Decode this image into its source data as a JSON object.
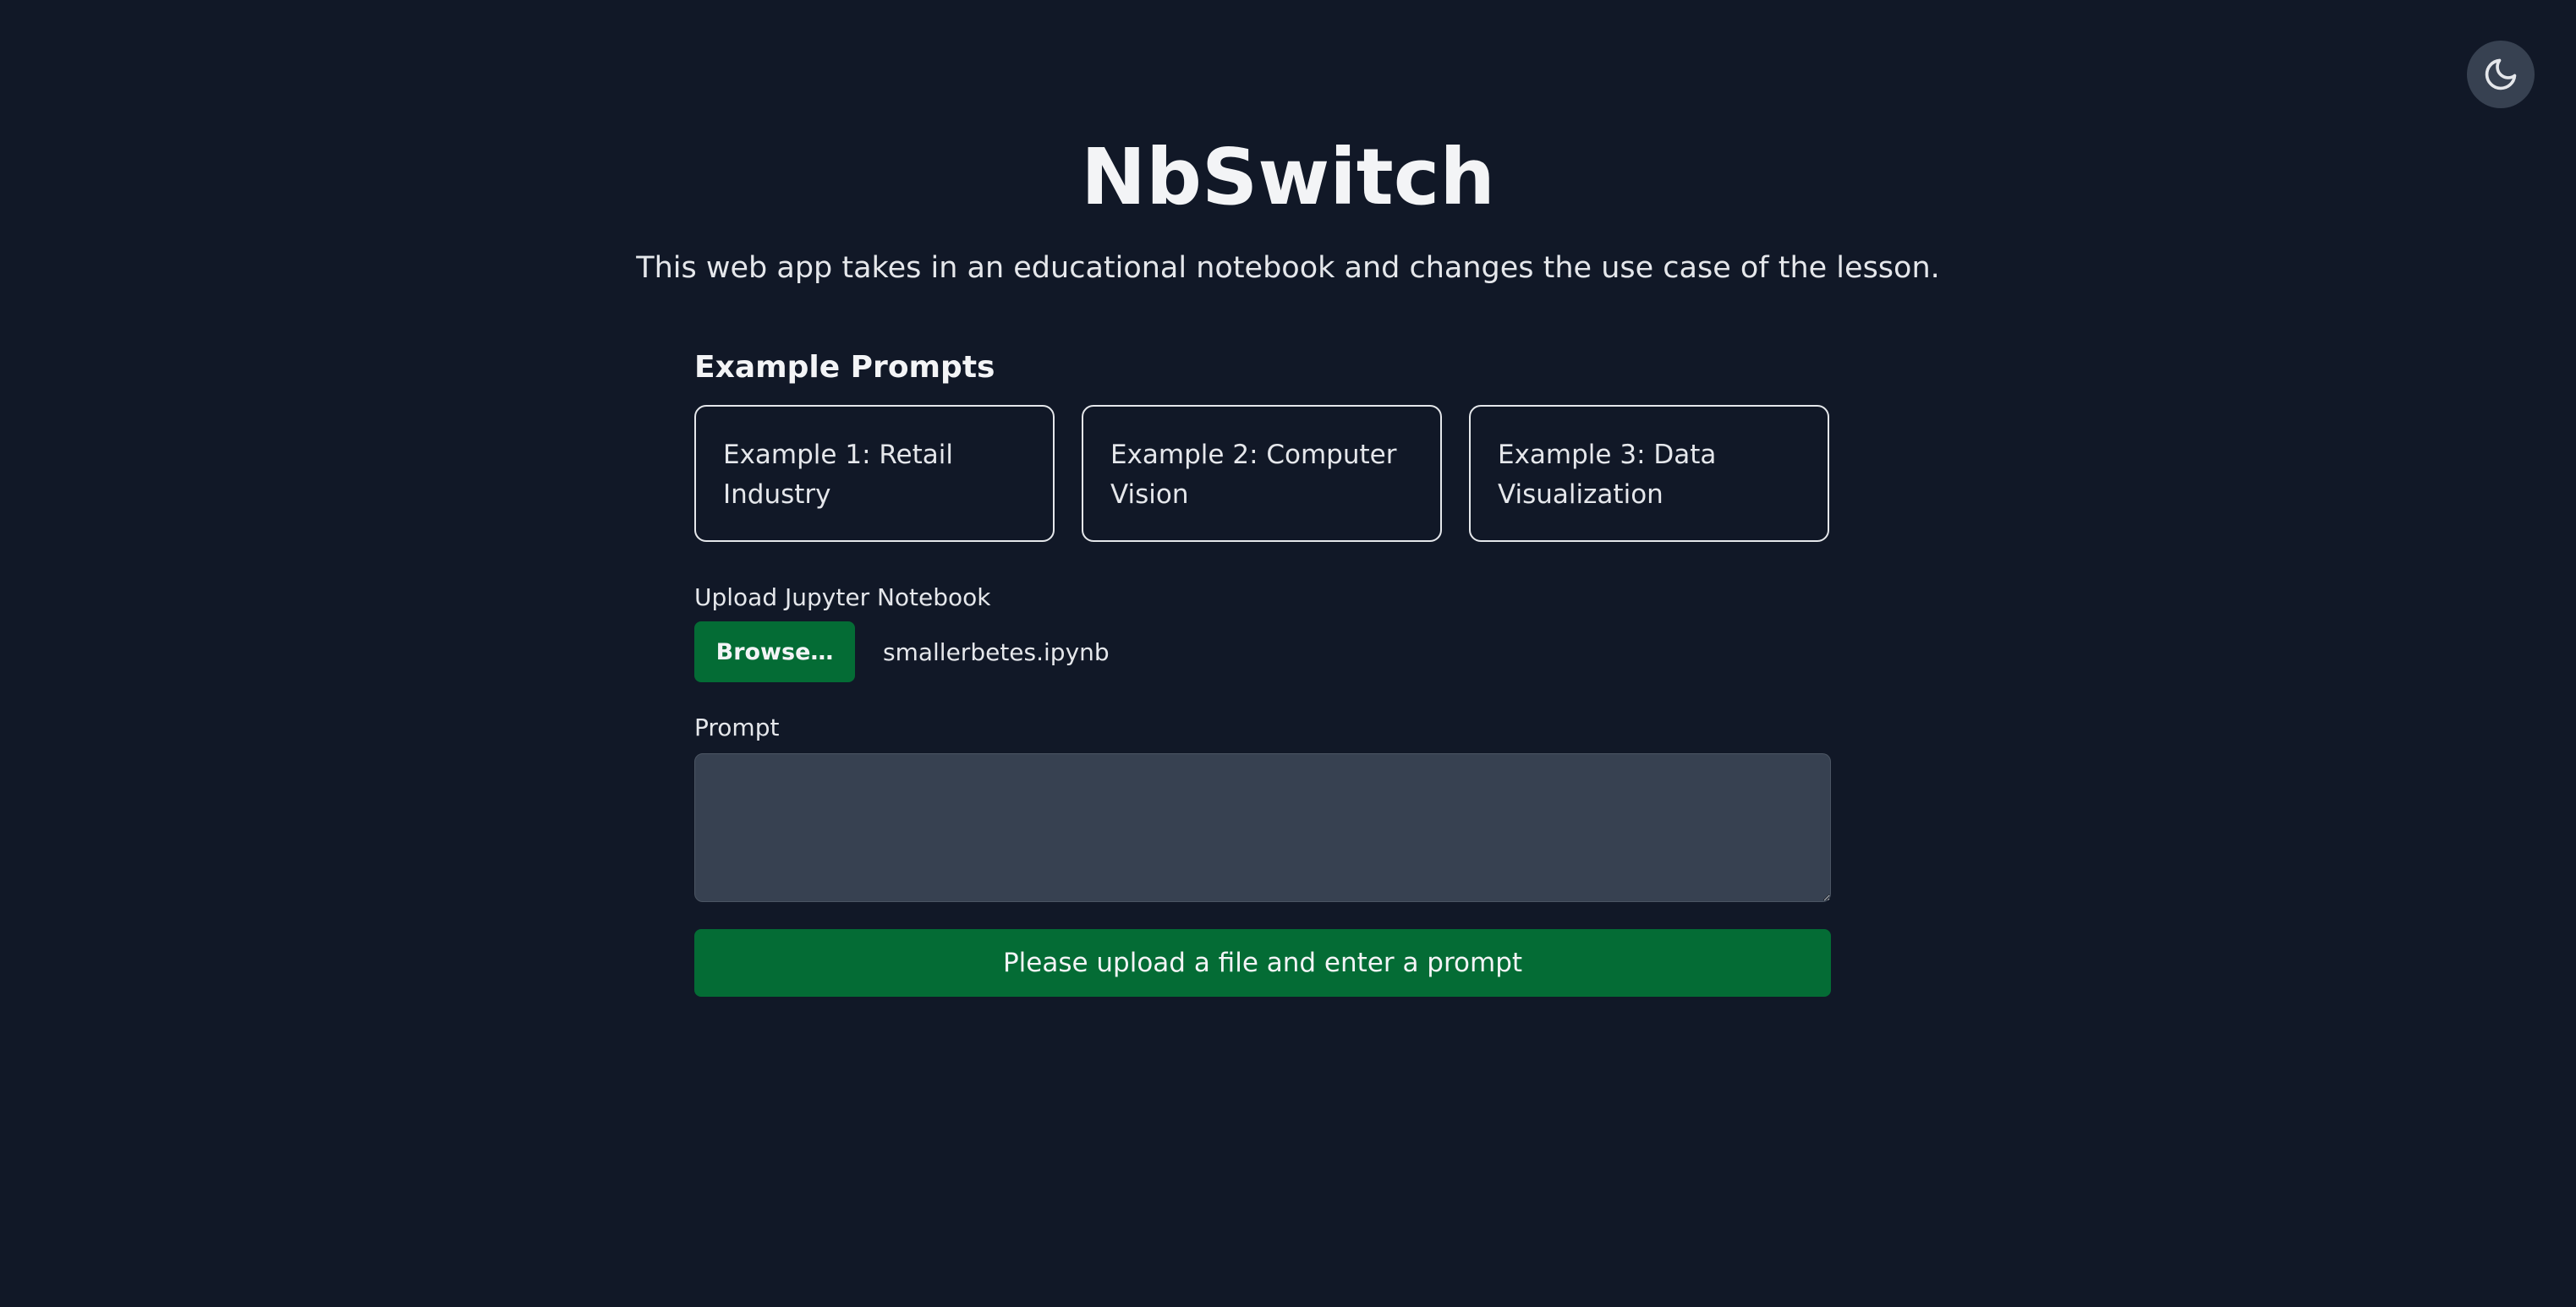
{
  "theme_toggle": {
    "icon": "moon-icon"
  },
  "header": {
    "title": "NbSwitch",
    "subtitle": "This web app takes in an educational notebook and changes the use case of the lesson."
  },
  "examples": {
    "title": "Example Prompts",
    "items": [
      {
        "label": "Example 1: Retail Industry"
      },
      {
        "label": "Example 2: Computer Vision"
      },
      {
        "label": "Example 3: Data Visualization"
      }
    ]
  },
  "upload": {
    "label": "Upload Jupyter Notebook",
    "button_label": "Browse…",
    "file_name": "smallerbetes.ipynb"
  },
  "prompt": {
    "label": "Prompt",
    "value": "",
    "placeholder": ""
  },
  "submit": {
    "label": "Please upload a file and enter a prompt"
  },
  "colors": {
    "background": "#111827",
    "accent": "#046c35",
    "input_background": "#374151",
    "text": "#f3f4f6"
  }
}
